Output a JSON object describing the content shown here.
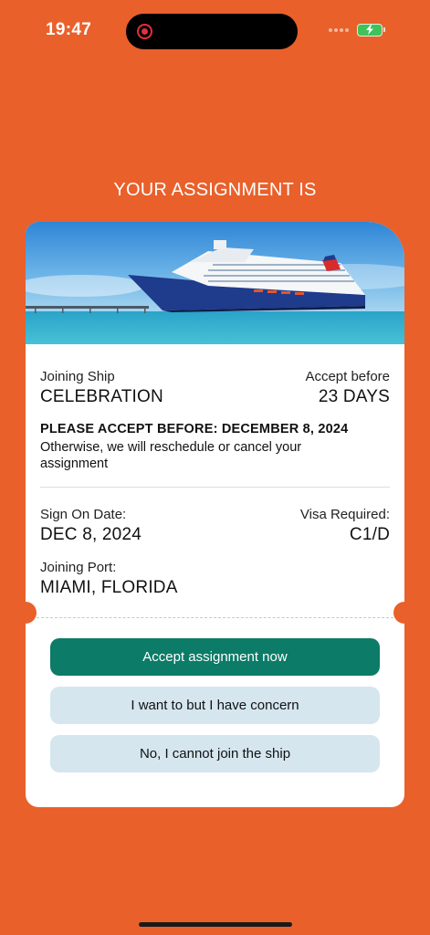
{
  "status_bar": {
    "time": "19:47"
  },
  "heading": "YOUR ASSIGNMENT IS",
  "assignment": {
    "ship_label": "Joining Ship",
    "ship_value": "CELEBRATION",
    "accept_label": "Accept before",
    "accept_value": "23 DAYS",
    "notice_title": "PLEASE ACCEPT BEFORE: DECEMBER 8, 2024",
    "notice_body": "Otherwise, we will reschedule or cancel your assignment",
    "sign_on_label": "Sign On Date:",
    "sign_on_value": "DEC 8, 2024",
    "visa_label": "Visa Required:",
    "visa_value": "C1/D",
    "port_label": "Joining Port:",
    "port_value": "MIAMI, FLORIDA"
  },
  "actions": {
    "accept": "Accept assignment now",
    "concern": "I want to but I have concern",
    "decline": "No, I cannot join the ship"
  },
  "colors": {
    "background": "#E9602B",
    "primary_button": "#0C7B67",
    "secondary_button": "#D5E6EF"
  },
  "icons": [
    "screen-record-icon",
    "signal-icon",
    "battery-charging-icon",
    "cruise-ship-image"
  ]
}
